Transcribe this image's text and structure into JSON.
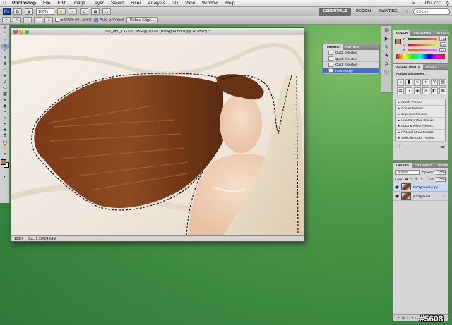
{
  "menubar": {
    "app_name": "Photoshop",
    "items": [
      "File",
      "Edit",
      "Image",
      "Layer",
      "Select",
      "Filter",
      "Analysis",
      "3D",
      "View",
      "Window",
      "Help"
    ],
    "clock": "Thu 7:31"
  },
  "appbar": {
    "logo": "Ps",
    "zoom": "100%",
    "workspaces": [
      "ESSENTIALS",
      "DESIGN",
      "PAINTING",
      "»"
    ],
    "search_label": "CS Live"
  },
  "options": {
    "sample_all_layers": "Sample All Layers",
    "auto_enhance": "Auto-Enhance",
    "refine_edge_button": "Refine Edge..."
  },
  "document": {
    "title": "Vol_080_DG198.JPG @ 100% (Background copy, RGB/8*) *",
    "zoom_status": "100%",
    "doc_size": "Doc: 1.19M/4.64M"
  },
  "history": {
    "tabs": [
      "HISTORY",
      "ACTIONS"
    ],
    "items": [
      "Quick Selection",
      "Quick Selection",
      "Quick Selection",
      "Refine Edge"
    ]
  },
  "color_panel": {
    "tabs": [
      "COLOR",
      "SWATCHES",
      "STYLES"
    ],
    "sliders": [
      {
        "label": "R",
        "value": "218"
      },
      {
        "label": "G",
        "value": "114"
      },
      {
        "label": "B",
        "value": "51"
      }
    ],
    "fg_color": "#da7233"
  },
  "adjustments": {
    "tabs": [
      "ADJUSTMENTS",
      "MASKS"
    ],
    "title": "Add an adjustment",
    "presets": [
      "Levels Presets",
      "Curves Presets",
      "Exposure Presets",
      "Hue/Saturation Presets",
      "Black & White Presets",
      "Channel Mixer Presets",
      "Selective Color Presets"
    ]
  },
  "layers": {
    "tabs": [
      "LAYERS",
      "CHANNELS",
      "PATHS"
    ],
    "blend_mode": "Normal",
    "opacity_label": "Opacity:",
    "opacity": "100%",
    "lock_label": "Lock:",
    "fill_label": "Fill:",
    "fill": "100%",
    "items": [
      {
        "name": "Background copy",
        "selected": true
      },
      {
        "name": "Background",
        "selected": false
      }
    ]
  },
  "watermark": "#5608"
}
